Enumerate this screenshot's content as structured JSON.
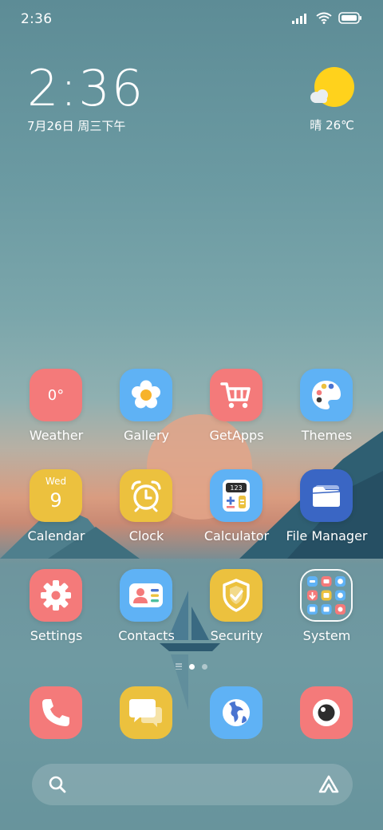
{
  "status_bar": {
    "time": "2:36"
  },
  "clock_widget": {
    "time": "2:36",
    "date": "7月26日 周三下午"
  },
  "weather_widget": {
    "text": "晴 26℃"
  },
  "apps": [
    {
      "id": "weather",
      "label": "Weather",
      "icon_text": "0°",
      "color": "#f47a7a"
    },
    {
      "id": "gallery",
      "label": "Gallery",
      "color": "#5fb2f5"
    },
    {
      "id": "getapps",
      "label": "GetApps",
      "color": "#f47a7a"
    },
    {
      "id": "themes",
      "label": "Themes",
      "color": "#5fb2f5"
    },
    {
      "id": "calendar",
      "label": "Calendar",
      "icon_day": "Wed",
      "icon_date": "9",
      "color": "#ecc13e"
    },
    {
      "id": "clock",
      "label": "Clock",
      "color": "#ecc13e"
    },
    {
      "id": "calculator",
      "label": "Calculator",
      "icon_text": "123",
      "color": "#5fb2f5"
    },
    {
      "id": "file-manager",
      "label": "File Manager",
      "color": "#3a66c4"
    },
    {
      "id": "settings",
      "label": "Settings",
      "color": "#f47a7a"
    },
    {
      "id": "contacts",
      "label": "Contacts",
      "color": "#5fb2f5"
    },
    {
      "id": "security",
      "label": "Security",
      "color": "#ecc13e"
    },
    {
      "id": "system",
      "label": "System",
      "color": "#6f9aa3"
    }
  ],
  "dock": [
    {
      "id": "phone",
      "icon": "phone-icon",
      "color": "#f47a7a"
    },
    {
      "id": "messages",
      "icon": "messages-icon",
      "color": "#ecc13e"
    },
    {
      "id": "browser",
      "icon": "globe-icon",
      "color": "#5fb2f5"
    },
    {
      "id": "camera",
      "icon": "camera-icon",
      "color": "#f47a7a"
    }
  ],
  "page_indicator": {
    "pages": 2,
    "current": 1
  }
}
